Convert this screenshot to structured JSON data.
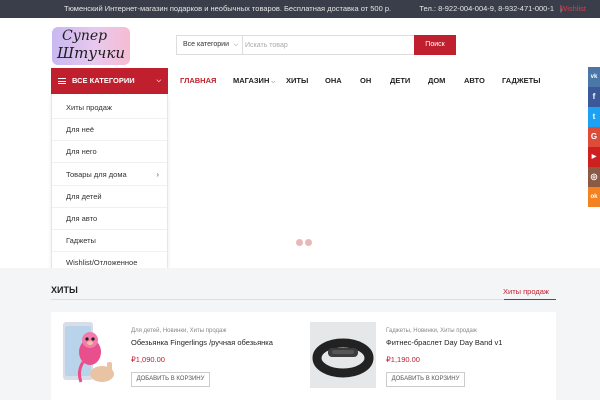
{
  "topbar": {
    "tagline": "Тюменский Интернет-магазин подарков и необычных товаров. Бесплатная доставка от 500 р.",
    "contacts": "Тел.: 8-922-004-004-9, 8-932-471-000-1",
    "separator": "|",
    "wishlist": "Wishlist"
  },
  "logo": {
    "line1": "Супер",
    "line2": "Штучки"
  },
  "search": {
    "category": "Все категории",
    "placeholder": "Искать товар",
    "button": "Поиск"
  },
  "categories": {
    "title": "ВСЕ КАТЕГОРИИ",
    "items": [
      {
        "label": "Хиты продаж",
        "arrow": ""
      },
      {
        "label": "Для неё",
        "arrow": ""
      },
      {
        "label": "Для него",
        "arrow": ""
      },
      {
        "label": "Товары для дома",
        "arrow": "›"
      },
      {
        "label": "Для детей",
        "arrow": ""
      },
      {
        "label": "Для авто",
        "arrow": ""
      },
      {
        "label": "Гаджеты",
        "arrow": ""
      },
      {
        "label": "Wishlist/Отложенное",
        "arrow": ""
      }
    ]
  },
  "nav": {
    "items": [
      {
        "label": "ГЛАВНАЯ",
        "active": true
      },
      {
        "label": "МАГАЗИН",
        "dropdown": true
      },
      {
        "label": "ХИТЫ"
      },
      {
        "label": "ОНА"
      },
      {
        "label": "ОН"
      },
      {
        "label": "ДЕТИ"
      },
      {
        "label": "ДОМ"
      },
      {
        "label": "АВТО"
      },
      {
        "label": "ГАДЖЕТЫ"
      }
    ]
  },
  "social": [
    {
      "icon": "vk-icon",
      "glyph": "vk",
      "color": "#4a76a8"
    },
    {
      "icon": "facebook-icon",
      "glyph": "f",
      "color": "#3b5998"
    },
    {
      "icon": "twitter-icon",
      "glyph": "t",
      "color": "#1da1f2"
    },
    {
      "icon": "google-plus-icon",
      "glyph": "G",
      "color": "#dd4b39"
    },
    {
      "icon": "youtube-icon",
      "glyph": "▶",
      "color": "#cd201f"
    },
    {
      "icon": "instagram-icon",
      "glyph": "◎",
      "color": "#8a5a44"
    },
    {
      "icon": "odnoklassniki-icon",
      "glyph": "ok",
      "color": "#f58220"
    }
  ],
  "hits": {
    "title": "ХИТЫ",
    "link": "Хиты продаж"
  },
  "products": [
    {
      "categories": "Для детей, Новинки, Хиты продаж",
      "name": "Обезьянка Fingerlings /ручная обезьянка",
      "price": "₽1,090.00",
      "button": "ДОБАВИТЬ В КОРЗИНУ"
    },
    {
      "categories": "Гаджеты, Новинки, Хиты продаж",
      "name": "Фитнес-браслет Day Day Band v1",
      "price": "₽1,190.00",
      "button": "ДОБАВИТЬ В КОРЗИНУ"
    }
  ],
  "colors": {
    "accent": "#c0202e",
    "topbar": "#3a3e4a",
    "lower_bg": "#f4f5f7"
  }
}
